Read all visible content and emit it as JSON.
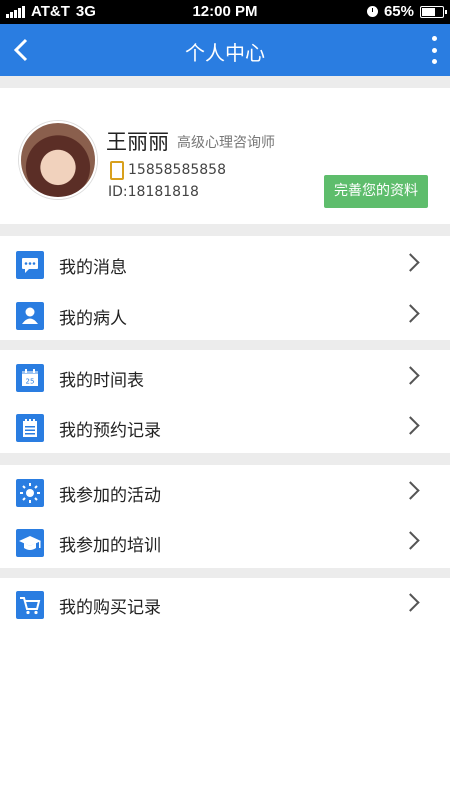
{
  "status_bar": {
    "carrier": "AT&T",
    "network": "3G",
    "time": "12:00 PM",
    "battery": "65%",
    "battery_level": 0.65
  },
  "nav": {
    "title": "个人中心",
    "back_icon": "chevron-left-icon",
    "more_icon": "more-vertical-icon"
  },
  "profile": {
    "name": "王丽丽",
    "role": "高级心理咨询师",
    "phone": "15858585858",
    "id_text": "ID:18181818",
    "complete_button": "完善您的资料"
  },
  "menu": [
    {
      "label": "我的消息",
      "icon": "message-icon"
    },
    {
      "label": "我的病人",
      "icon": "person-icon"
    },
    {
      "label": "我的时间表",
      "icon": "calendar-icon",
      "icon_text": "25"
    },
    {
      "label": "我的预约记录",
      "icon": "notepad-icon"
    },
    {
      "label": "我参加的活动",
      "icon": "sun-icon"
    },
    {
      "label": "我参加的培训",
      "icon": "graduation-cap-icon"
    },
    {
      "label": "我的购买记录",
      "icon": "cart-icon"
    }
  ],
  "colors": {
    "primary": "#2a7de1",
    "button_green": "#5ebd6c",
    "background_gray": "#ececec"
  }
}
